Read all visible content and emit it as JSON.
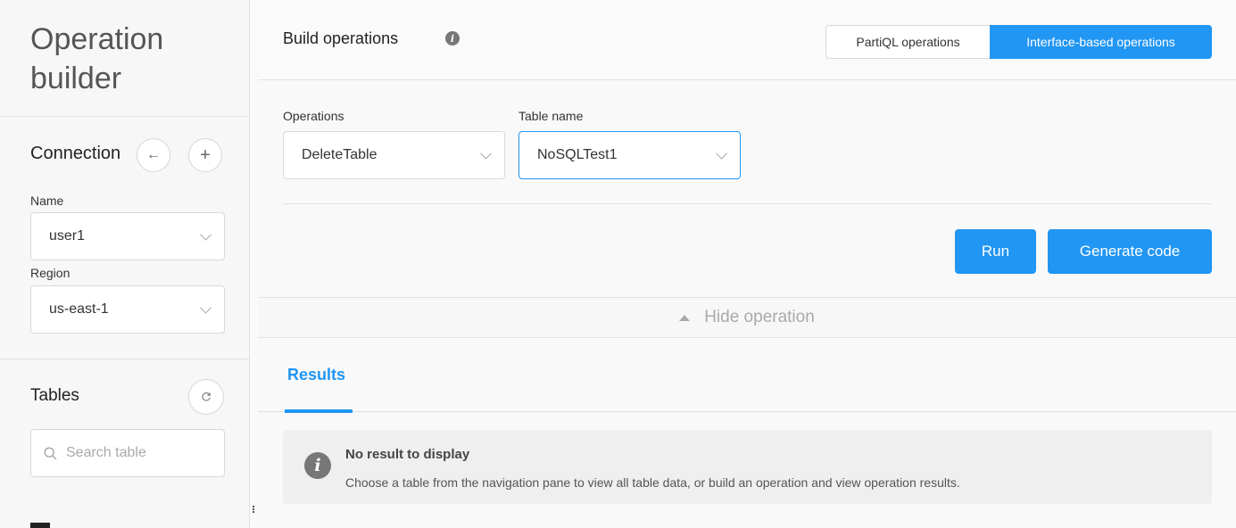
{
  "sidebar": {
    "title": "Operation builder",
    "connection": {
      "label": "Connection",
      "back_icon": "arrow-left-icon",
      "add_icon": "plus-icon",
      "name_label": "Name",
      "name_value": "user1",
      "region_label": "Region",
      "region_value": "us-east-1"
    },
    "tables": {
      "label": "Tables",
      "refresh_icon": "refresh-icon",
      "search_placeholder": "Search table"
    }
  },
  "header": {
    "title": "Build operations",
    "mode_tabs": [
      {
        "label": "PartiQL operations",
        "selected": false
      },
      {
        "label": "Interface-based operations",
        "selected": true
      }
    ]
  },
  "form": {
    "operations_label": "Operations",
    "operations_value": "DeleteTable",
    "table_label": "Table name",
    "table_value": "NoSQLTest1"
  },
  "actions": {
    "run_label": "Run",
    "generate_label": "Generate code"
  },
  "toggle": {
    "hide_label": "Hide operation"
  },
  "results": {
    "tab_label": "Results",
    "alert_title": "No result to display",
    "alert_text": "Choose a table from the navigation pane to view all table data, or build an operation and view operation results."
  },
  "colors": {
    "accent": "#2196f3",
    "sidebar_bg": "#f7f7f7",
    "alert_bg": "#efefef"
  }
}
